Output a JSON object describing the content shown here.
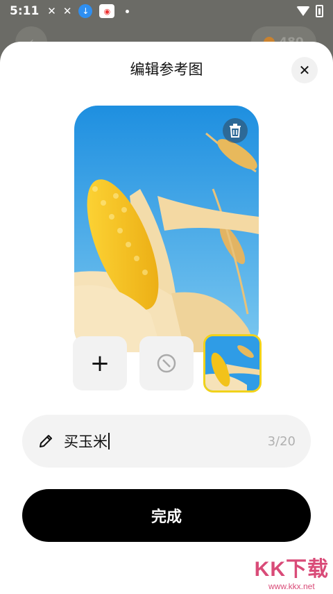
{
  "status_bar": {
    "time": "5:11",
    "icons": [
      "x-notification-icon",
      "x-notification-icon",
      "download-icon",
      "app-icon",
      "dot-icon",
      "wifi-icon",
      "battery-icon"
    ]
  },
  "background_app": {
    "coins": "480"
  },
  "sheet": {
    "title": "编辑参考图",
    "close_icon": "close-icon",
    "delete_icon": "trash-icon"
  },
  "thumbnails": [
    {
      "kind": "add",
      "icon": "plus-icon"
    },
    {
      "kind": "none",
      "icon": "no-entry-icon"
    },
    {
      "kind": "image",
      "selected": true
    }
  ],
  "prompt": {
    "value": "买玉米",
    "counter": "3/20",
    "icon": "pencil-icon"
  },
  "done_label": "完成",
  "watermark": {
    "logo": "KK下载",
    "url": "www.kkx.net"
  },
  "colors": {
    "accent_selected": "#f1d21a",
    "done_button": "#000000",
    "sky": "#39a5e8",
    "corn": "#f2c21a"
  }
}
